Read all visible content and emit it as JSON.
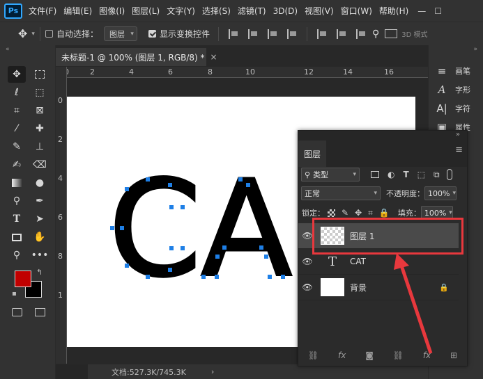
{
  "app": {
    "logo": "Ps"
  },
  "menu": [
    "文件(F)",
    "编辑(E)",
    "图像(I)",
    "图层(L)",
    "文字(Y)",
    "选择(S)",
    "滤镜(T)",
    "3D(D)",
    "视图(V)",
    "窗口(W)",
    "帮助(H)"
  ],
  "window_controls": {
    "minimize": "—",
    "maximize": "☐"
  },
  "options": {
    "auto_select_label": "自动选择：",
    "auto_select_value": "图层",
    "show_transform_label": "显示变换控件",
    "mode_3d_label": "3D 模式"
  },
  "document": {
    "tab_title": "未标题-1 @ 100% (图层 1, RGB/8) *",
    "close": "×"
  },
  "ruler": {
    "top": [
      "0",
      "2",
      "4",
      "6",
      "8",
      "10",
      "12",
      "14",
      "16"
    ],
    "left": [
      "0",
      "2",
      "4",
      "6",
      "8",
      "1"
    ]
  },
  "canvas": {
    "text": "CA"
  },
  "status": {
    "doc_info": "文档:527.3K/745.3K",
    "arrow": "›"
  },
  "right_panel": [
    {
      "icon": "paintbrush-icon",
      "label": "画笔"
    },
    {
      "icon": "character-icon",
      "label": "字形"
    },
    {
      "icon": "glyph-icon",
      "label": "字符"
    },
    {
      "icon": "properties-icon",
      "label": "属性"
    }
  ],
  "layers_panel": {
    "title": "图层",
    "collapse": "»",
    "menu": "≡",
    "filter_type": "类型",
    "blend_mode": "正常",
    "opacity_label": "不透明度：",
    "opacity_value": "100%",
    "lock_label": "锁定：",
    "fill_label": "填充：",
    "fill_value": "100%",
    "layers": [
      {
        "name": "图层 1",
        "type": "pixel",
        "selected": true
      },
      {
        "name": "CAT",
        "type": "text",
        "selected": false
      },
      {
        "name": "背景",
        "type": "background",
        "selected": false,
        "locked": true
      }
    ]
  },
  "colors": {
    "foreground": "#c00000",
    "background": "#000000",
    "accent": "#31a8ff",
    "highlight": "#e8383d"
  }
}
